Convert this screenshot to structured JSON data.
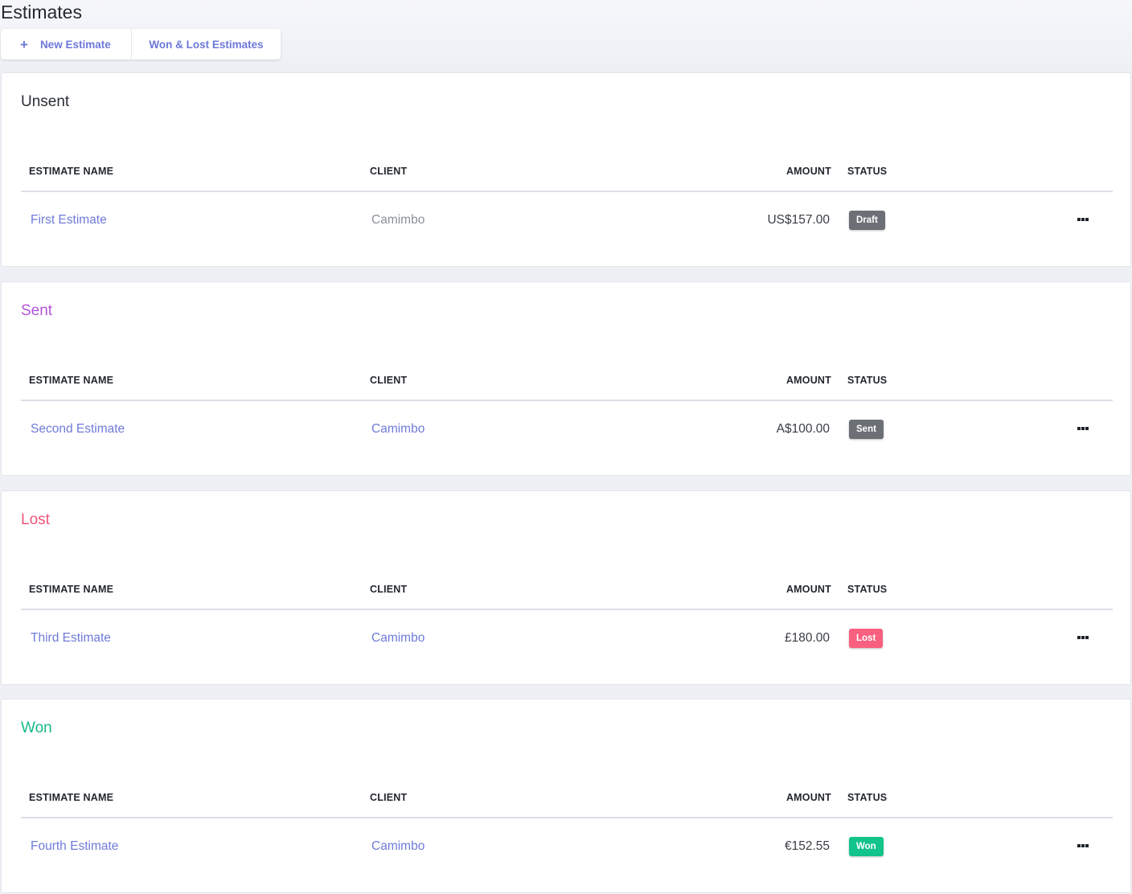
{
  "page": {
    "title": "Estimates"
  },
  "toolbar": {
    "new_label": "New Estimate",
    "won_lost_label": "Won & Lost Estimates"
  },
  "columns": {
    "name": "ESTIMATE NAME",
    "client": "CLIENT",
    "amount": "AMOUNT",
    "status": "STATUS"
  },
  "sections": [
    {
      "title": "Unsent",
      "title_color": "#2a2e35",
      "row": {
        "name": "First Estimate",
        "client": "Camimbo",
        "amount": "US$157.00",
        "status": "Draft",
        "status_color": "#6c6f75"
      }
    },
    {
      "title": "Sent",
      "title_color": "#b455d8",
      "row": {
        "name": "Second Estimate",
        "client": "Camimbo",
        "amount": "A$100.00",
        "status": "Sent",
        "status_color": "#6c6f75"
      }
    },
    {
      "title": "Lost",
      "title_color": "#f0557a",
      "row": {
        "name": "Third Estimate",
        "client": "Camimbo",
        "amount": "£180.00",
        "status": "Lost",
        "status_color": "#f95f7f"
      }
    },
    {
      "title": "Won",
      "title_color": "#17b98a",
      "row": {
        "name": "Fourth Estimate",
        "client": "Camimbo",
        "amount": "€152.55",
        "status": "Won",
        "status_color": "#12c38a"
      }
    }
  ],
  "colors": {
    "link": "#6f7bd8",
    "background": "#eef0f5"
  },
  "icons": {
    "add": "plus-icon",
    "row_actions": "more-horizontal-icon"
  }
}
